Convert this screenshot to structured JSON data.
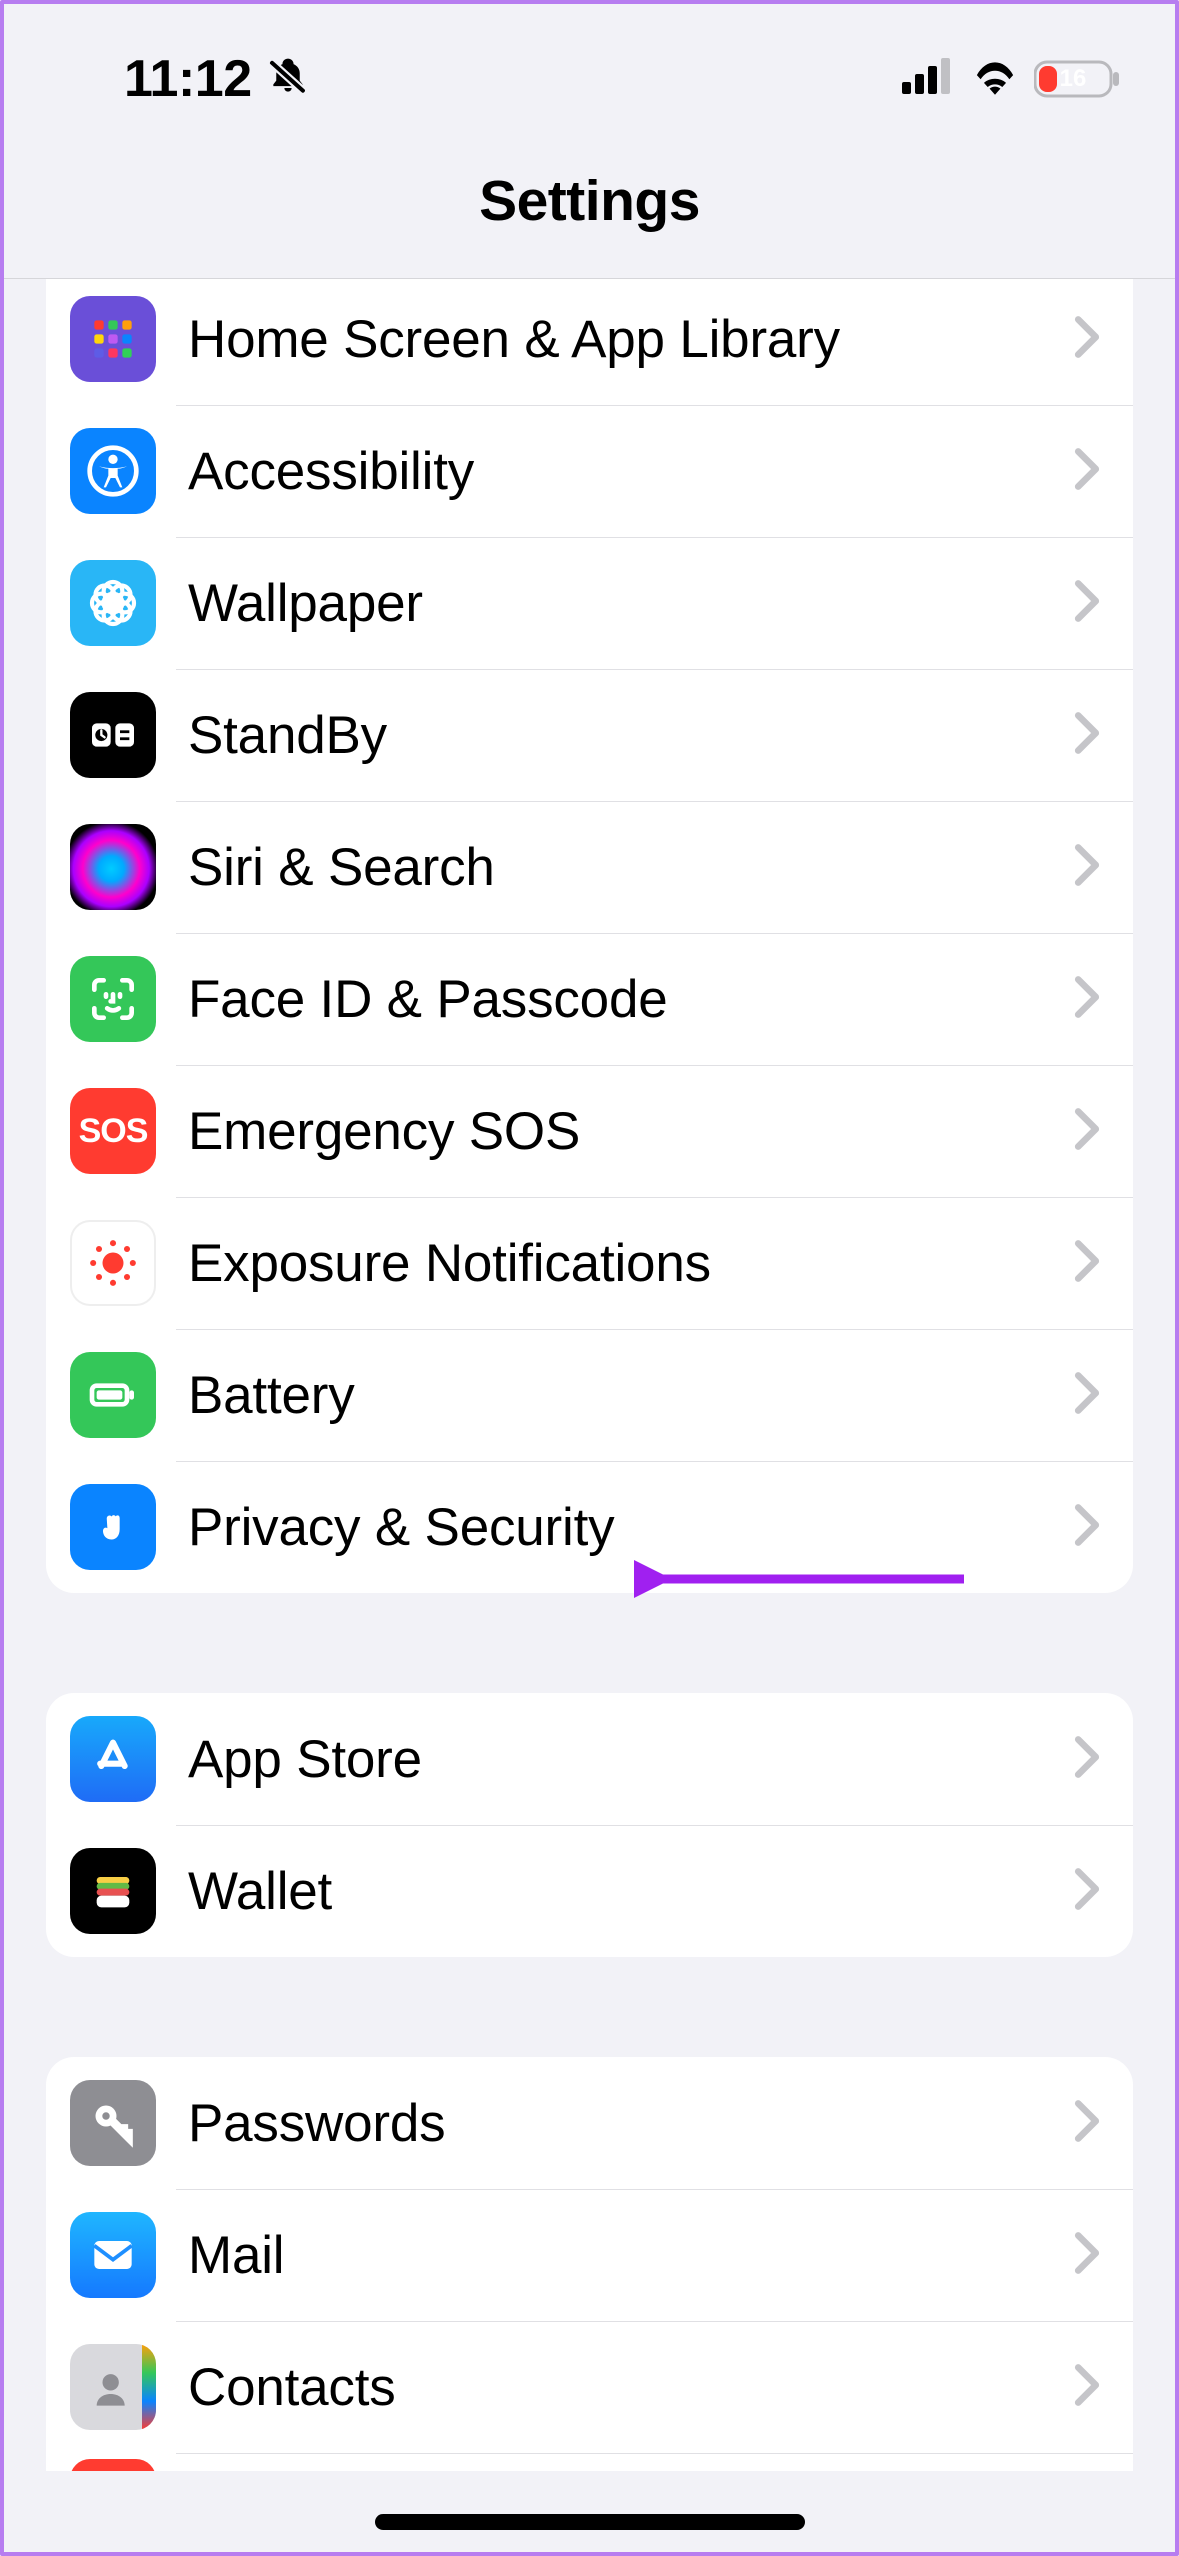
{
  "status": {
    "time": "11:12",
    "silent": true,
    "signal_bars": 4,
    "wifi": true,
    "battery_percent": "16",
    "battery_low": true
  },
  "header": {
    "title": "Settings"
  },
  "groups": [
    {
      "id": "system",
      "partial_above": true,
      "rows": [
        {
          "id": "home-screen",
          "label": "Home Screen & App Library",
          "icon": "home-screen-icon",
          "icon_class": "ic-home"
        },
        {
          "id": "accessibility",
          "label": "Accessibility",
          "icon": "accessibility-icon",
          "icon_class": "ic-access"
        },
        {
          "id": "wallpaper",
          "label": "Wallpaper",
          "icon": "wallpaper-icon",
          "icon_class": "ic-wallpaper"
        },
        {
          "id": "standby",
          "label": "StandBy",
          "icon": "standby-icon",
          "icon_class": "ic-standby"
        },
        {
          "id": "siri",
          "label": "Siri & Search",
          "icon": "siri-icon",
          "icon_class": "ic-siri"
        },
        {
          "id": "faceid",
          "label": "Face ID & Passcode",
          "icon": "faceid-icon",
          "icon_class": "ic-faceid"
        },
        {
          "id": "sos",
          "label": "Emergency SOS",
          "icon": "sos-icon",
          "icon_class": "ic-sos",
          "icon_text": "SOS"
        },
        {
          "id": "exposure",
          "label": "Exposure Notifications",
          "icon": "exposure-icon",
          "icon_class": "ic-exposure"
        },
        {
          "id": "battery",
          "label": "Battery",
          "icon": "battery-icon",
          "icon_class": "ic-battery"
        },
        {
          "id": "privacy",
          "label": "Privacy & Security",
          "icon": "privacy-icon",
          "icon_class": "ic-privacy",
          "annotate_arrow": true
        }
      ]
    },
    {
      "id": "store",
      "rows": [
        {
          "id": "appstore",
          "label": "App Store",
          "icon": "appstore-icon",
          "icon_class": "ic-appstore"
        },
        {
          "id": "wallet",
          "label": "Wallet",
          "icon": "wallet-icon",
          "icon_class": "ic-wallet"
        }
      ]
    },
    {
      "id": "accounts",
      "rows": [
        {
          "id": "passwords",
          "label": "Passwords",
          "icon": "passwords-icon",
          "icon_class": "ic-passwords"
        },
        {
          "id": "mail",
          "label": "Mail",
          "icon": "mail-icon",
          "icon_class": "ic-mail"
        },
        {
          "id": "contacts",
          "label": "Contacts",
          "icon": "contacts-icon",
          "icon_class": "ic-contacts"
        }
      ],
      "partial_below": true
    }
  ],
  "annotation": {
    "arrow_color": "#a020f0"
  }
}
